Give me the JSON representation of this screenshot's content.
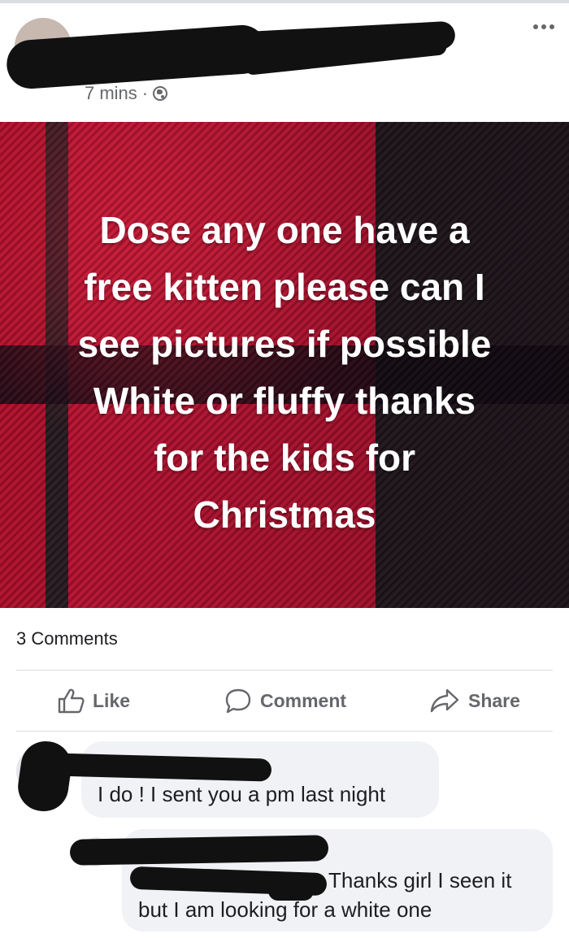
{
  "post": {
    "timestamp": "7 mins",
    "separator": "·",
    "privacy_icon": "globe-icon",
    "menu_icon": "more-dots-icon",
    "text_lines": [
      "Dose any one have a",
      "free kitten please can I",
      "see pictures if possible",
      "White or fluffy thanks",
      "for the kids for",
      "Christmas"
    ]
  },
  "comments_count": "3 Comments",
  "actions": {
    "like": "Like",
    "comment": "Comment",
    "share": "Share"
  },
  "comments": [
    {
      "text": "I do ! I sent you a pm last night"
    },
    {
      "text_line1": "Thanks girl I seen it",
      "text_line2": "but I am looking for a white one"
    }
  ],
  "colors": {
    "action_gray": "#65676b",
    "bubble_bg": "#f0f2f5",
    "divider": "#dadde1"
  }
}
